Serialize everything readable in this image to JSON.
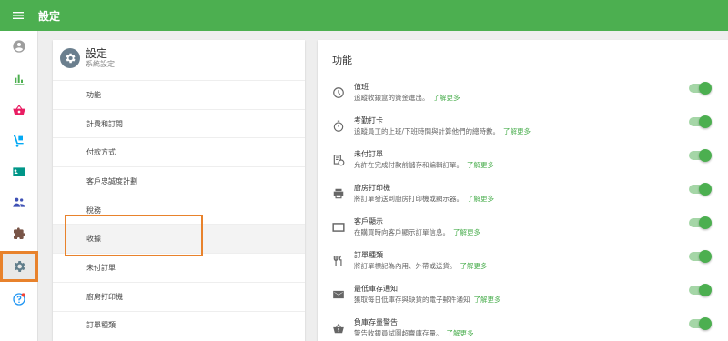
{
  "header": {
    "title": "設定",
    "menu_icon": "menu-icon"
  },
  "sidebar": {
    "items": [
      {
        "name": "account",
        "icon": "account-circle-icon",
        "color": "#9e9e9e"
      },
      {
        "name": "reports",
        "icon": "bar-chart-icon",
        "color": "#4caf50"
      },
      {
        "name": "sales",
        "icon": "basket-icon",
        "color": "#e91e63"
      },
      {
        "name": "inventory",
        "icon": "hand-truck-icon",
        "color": "#03a9f4"
      },
      {
        "name": "employees",
        "icon": "badge-icon",
        "color": "#009688"
      },
      {
        "name": "customers",
        "icon": "people-icon",
        "color": "#3f51b5"
      },
      {
        "name": "addons",
        "icon": "puzzle-icon",
        "color": "#795548"
      },
      {
        "name": "settings",
        "icon": "gear-icon",
        "color": "#607d8b",
        "active": true
      },
      {
        "name": "help",
        "icon": "help-icon",
        "color": "#2196f3"
      }
    ]
  },
  "settings_panel": {
    "title": "設定",
    "subtitle": "系統設定",
    "items": [
      "功能",
      "計費和訂閱",
      "付款方式",
      "客戶忠誠度計劃",
      "稅務",
      "收據",
      "未付訂單",
      "廚房打印機",
      "訂單種類"
    ],
    "selected_index": 5
  },
  "features_panel": {
    "title": "功能",
    "link_label": "了解更多",
    "features": [
      {
        "name": "值班",
        "desc": "追蹤收銀盒的資金進出。",
        "enabled": true
      },
      {
        "name": "考勤打卡",
        "desc": "追蹤員工的上班/下班時間與計算他們的總時數。",
        "enabled": true
      },
      {
        "name": "未付訂單",
        "desc": "允許在完成付款前儲存和編輯訂單。",
        "enabled": true
      },
      {
        "name": "廚房打印機",
        "desc": "將訂單發送到廚房打印機或顯示器。",
        "enabled": true
      },
      {
        "name": "客戶顯示",
        "desc": "在購買時向客戶顯示訂單信息。",
        "enabled": true
      },
      {
        "name": "訂單種類",
        "desc": "將訂單標記為內用、外帶或送貨。",
        "enabled": true
      },
      {
        "name": "最低庫存通知",
        "desc": "獲取每日低庫存與缺貨的電子郵件通知",
        "enabled": true
      },
      {
        "name": "負庫存量警告",
        "desc": "警告收銀員試圖超賣庫存量。",
        "enabled": true
      }
    ]
  },
  "colors": {
    "brand": "#4caf50",
    "highlight": "#e8822c"
  }
}
